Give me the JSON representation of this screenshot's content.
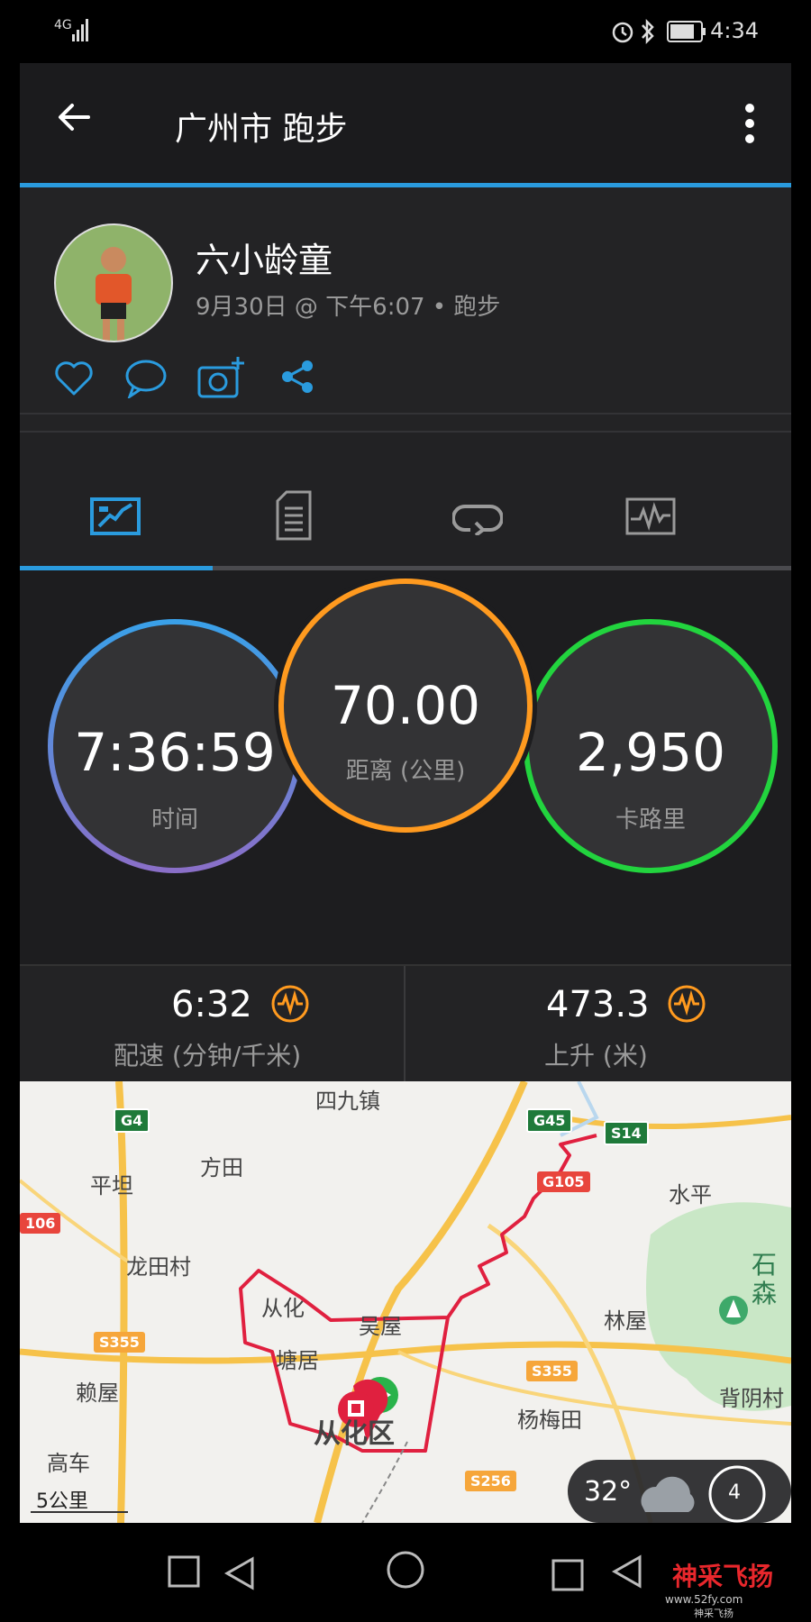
{
  "status_bar": {
    "signal": "4G",
    "time": "4:34"
  },
  "header": {
    "title": "广州市 跑步"
  },
  "profile": {
    "name": "六小龄童",
    "meta": "9月30日 @ 下午6:07 • 跑步"
  },
  "stats": {
    "time_value": "7:36:59",
    "time_label": "时间",
    "distance_value": "70.00",
    "distance_label": "距离 (公里)",
    "calories_value": "2,950",
    "calories_label": "卡路里"
  },
  "metrics": {
    "pace_value": "6:32",
    "pace_label": "配速 (分钟/千米)",
    "ascent_value": "473.3",
    "ascent_label": "上升 (米)"
  },
  "map": {
    "places": [
      "四九镇",
      "平坦",
      "方田",
      "水平",
      "龙田村",
      "从化",
      "吴屋",
      "林屋",
      "塘居",
      "赖屋",
      "杨梅田",
      "从化区",
      "背阴村",
      "高车"
    ],
    "roads": [
      "G4",
      "G45",
      "S14",
      "G105",
      "106",
      "S355",
      "S355",
      "S256"
    ],
    "scale": "5公里",
    "temperature": "32°",
    "park_label": "石森",
    "compass_value": "4"
  },
  "watermark": {
    "text": "神采飞扬",
    "url": "www.52fy.com",
    "sub": "神采飞扬"
  },
  "colors": {
    "accent": "#2a9bde",
    "time_ring_top": "#3aa0e8",
    "time_ring_bottom": "#8a6fc8",
    "distance_ring": "#ff9a1f",
    "calories_ring": "#22d43e",
    "route": "#e0203f",
    "watermark": "#e8272c"
  }
}
